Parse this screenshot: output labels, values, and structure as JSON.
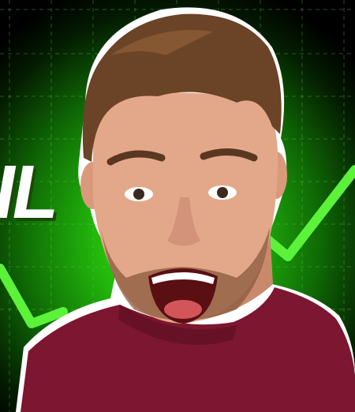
{
  "scene": {
    "description_colors": {
      "background_bright": "#3ee81a",
      "background_dark": "#041c01",
      "trend_line": "#5cf23a",
      "shirt": "#7d1630",
      "skin": "#e3a88a",
      "hair": "#6b4326"
    },
    "partial_text": "IL",
    "subject": "excited-man-portrait",
    "icons": [
      "trend-up-line"
    ]
  }
}
